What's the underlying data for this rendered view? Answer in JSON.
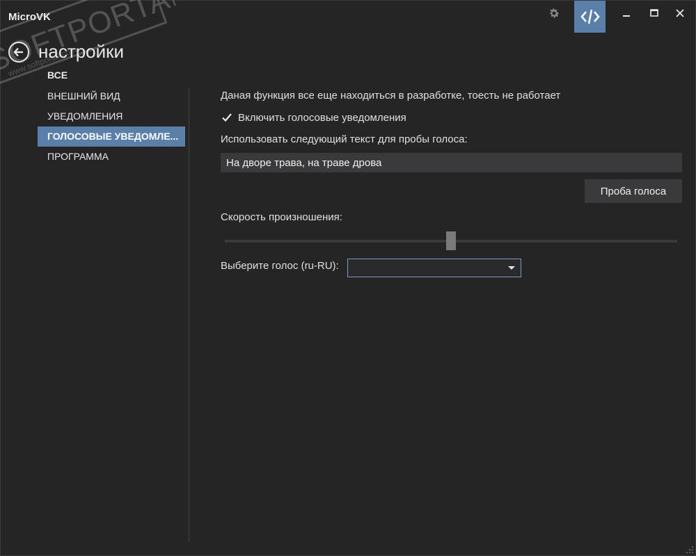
{
  "app": {
    "title": "MicroVK"
  },
  "header": {
    "page_title": "настройки"
  },
  "watermark": {
    "brand": "SOFTPORTAL",
    "tm": "™",
    "url": "www.softportal.com"
  },
  "nav": {
    "items": [
      {
        "label": "ВСЕ"
      },
      {
        "label": "ВНЕШНИЙ ВИД"
      },
      {
        "label": "УВЕДОМЛЕНИЯ"
      },
      {
        "label": "ГОЛОСОВЫЕ УВЕДОМЛЕ..."
      },
      {
        "label": "ПРОГРАММА"
      }
    ],
    "active_index": 3
  },
  "content": {
    "notice": "Даная функция все еще находиться в разработке, тоесть не работает",
    "enable_voice": {
      "label": "Включить голосовые уведомления",
      "checked": true
    },
    "sample_text_label": "Использовать следующий текст для пробы голоса:",
    "sample_text_value": "На дворе трава, на траве дрова",
    "test_button": "Проба голоса",
    "speed_label": "Скорость произношения:",
    "speed_value": 0.5,
    "voice_label": "Выберите голос (ru-RU):",
    "voice_value": ""
  },
  "colors": {
    "accent": "#5a7fa8",
    "background": "#252526",
    "control": "#3a3a3c"
  },
  "icons": {
    "settings": "gear-icon",
    "developer": "code-icon",
    "back": "arrow-left-icon"
  }
}
